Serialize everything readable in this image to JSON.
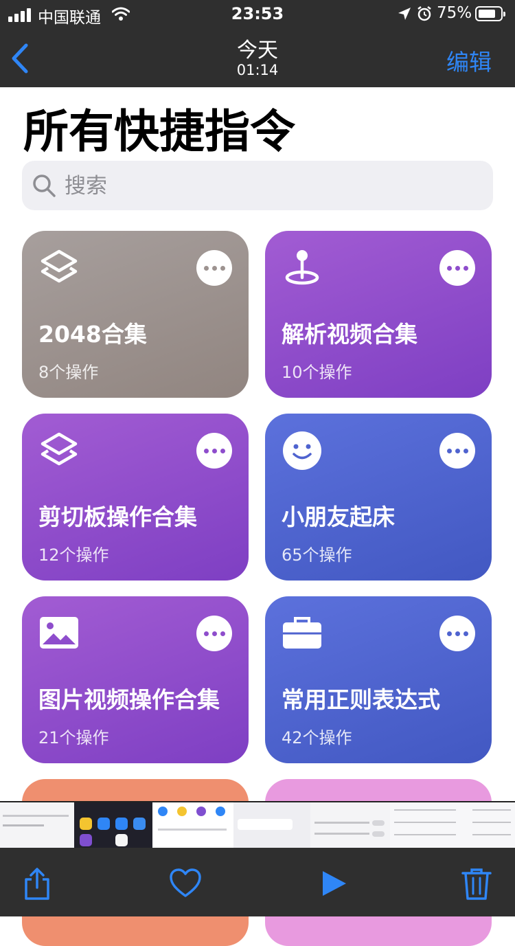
{
  "status_bar": {
    "carrier": "中国联通",
    "time": "23:53",
    "battery": "75%",
    "battery_level": 0.75
  },
  "nav": {
    "title": "今天",
    "subtitle": "01:14",
    "edit_label": "编辑"
  },
  "page_title": "所有快捷指令",
  "search": {
    "placeholder": "搜索"
  },
  "shortcuts": [
    {
      "name": "2048合集",
      "count": "8个操作",
      "icon": "layers-icon",
      "color": "gray"
    },
    {
      "name": "解析视频合集",
      "count": "10个操作",
      "icon": "pin-icon",
      "color": "purple"
    },
    {
      "name": "剪切板操作合集",
      "count": "12个操作",
      "icon": "layers-icon",
      "color": "purple"
    },
    {
      "name": "小朋友起床",
      "count": "65个操作",
      "icon": "smiley-icon",
      "color": "blue"
    },
    {
      "name": "图片视频操作合集",
      "count": "21个操作",
      "icon": "photo-icon",
      "color": "purple"
    },
    {
      "name": "常用正则表达式",
      "count": "42个操作",
      "icon": "briefcase-icon",
      "color": "blue"
    }
  ],
  "colors": {
    "accent": "#2f86f6",
    "bar_bg": "#2f2f2f",
    "card_gray": "#a29896",
    "card_purple": "#8f4ccb",
    "card_blue": "#4f63cf",
    "card_peach": "#ef8f6f",
    "card_pink": "#e89adf"
  },
  "toolbar": {
    "icons": [
      "share-icon",
      "heart-icon",
      "play-icon",
      "trash-icon"
    ]
  }
}
